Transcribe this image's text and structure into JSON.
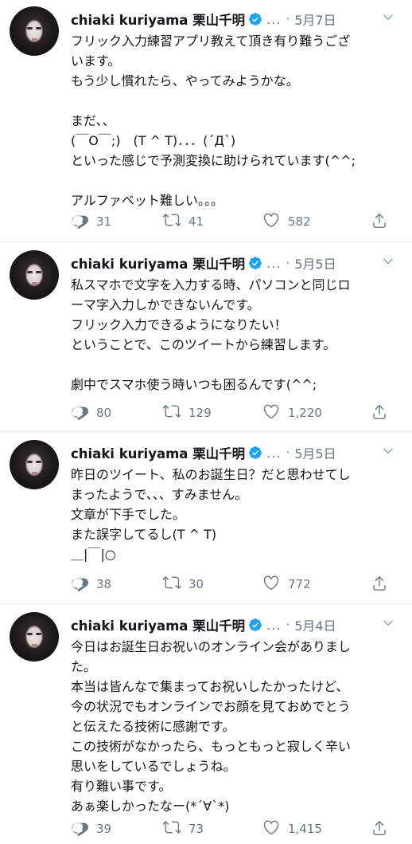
{
  "tweets": [
    {
      "name": "chiaki kuriyama 栗山千明",
      "handle": "...",
      "date": "5月7日",
      "lines": [
        "フリック入力練習アプリ教えて頂き有り難うござ",
        "います。",
        "もう少し慣れたら、やってみようかな。",
        "",
        "まだ、、",
        "(￣O￣;)　(T ^ T)．．．(´Д`)",
        "といった感じで予測変換に助けられています(^^;",
        "",
        "アルファベット難しい。。。"
      ],
      "replies": "31",
      "retweets": "41",
      "likes": "582"
    },
    {
      "name": "chiaki kuriyama 栗山千明",
      "handle": "...",
      "date": "5月5日",
      "lines": [
        "私スマホで文字を入力する時、パソコンと同じロ",
        "ーマ字入力しかできないんです。",
        "フリック入力できるようになりたい！",
        "ということで、このツイートから練習します。",
        "",
        "劇中でスマホ使う時いつも困るんです(^^;"
      ],
      "replies": "80",
      "retweets": "129",
      "likes": "1,220"
    },
    {
      "name": "chiaki kuriyama 栗山千明",
      "handle": "...",
      "date": "5月5日",
      "lines": [
        "昨日のツイート、私のお誕生日？だと思わせてし",
        "まったようで、、、すみません。",
        "文章が下手でした。",
        "また誤字してるし(T ^ T)",
        "＿|￣|○"
      ],
      "replies": "38",
      "retweets": "30",
      "likes": "772"
    },
    {
      "name": "chiaki kuriyama 栗山千明",
      "handle": "...",
      "date": "5月4日",
      "lines": [
        "今日はお誕生日お祝いのオンライン会がありまし",
        "た。",
        "本当は皆んなで集まってお祝いしたかったけど、",
        "今の状況でもオンラインでお顔を見ておめでとう",
        "と伝えたる技術に感謝です。",
        "この技術がなかったら、もっともっと寂しく辛い",
        "思いをしているでしょうね。",
        "有り難い事です。",
        "あぁ楽しかったなー(*´∀`*)"
      ],
      "replies": "39",
      "retweets": "73",
      "likes": "1,415"
    }
  ],
  "icons": {
    "reply": "reply-icon",
    "retweet": "retweet-icon",
    "like": "heart-icon",
    "share": "share-icon",
    "verified": "verified-badge-icon",
    "more": "chevron-down-icon"
  },
  "colors": {
    "text": "#14171a",
    "secondary": "#657786",
    "verified": "#1da1f2",
    "divider": "#e6ecf0"
  }
}
